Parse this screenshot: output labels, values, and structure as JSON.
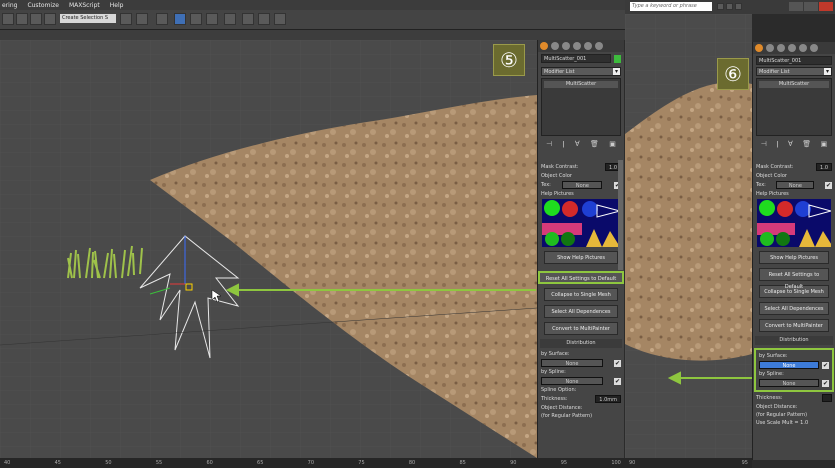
{
  "menu": [
    "ering",
    "Customize",
    "MAXScript",
    "Help"
  ],
  "toolbar": {
    "selection_filter": "Create Selection S"
  },
  "search": {
    "placeholder": "Type a keyword or phrase"
  },
  "ruler": [
    "40",
    "45",
    "50",
    "55",
    "60",
    "65",
    "70",
    "75",
    "80",
    "85",
    "90",
    "95",
    "100"
  ],
  "ruler2": [
    "90",
    "95"
  ],
  "steps": {
    "left": "⑤",
    "right": "⑥"
  },
  "left_panel": {
    "object_name": "MultiScatter_001",
    "modifier_list": "Modifier List",
    "stack_item": "MultiScatter",
    "mask_contrast_label": "Mask Contrast:",
    "mask_contrast_value": "1.0",
    "object_color_label": "Object Color",
    "tex_label": "Tex:",
    "tex_value": "None",
    "help_pictures_label": "Help Pictures",
    "show_help": "Show Help Pictures",
    "reset": "Reset All Settings to Default",
    "collapse": "Collapse to Single Mesh",
    "select_deps": "Select All Dependences",
    "convert": "Convert to MultiPainter",
    "distribution": "Distribution",
    "by_surface": "by Surface:",
    "surface_value": "None",
    "by_spline": "by Spline:",
    "spline_value": "None",
    "spline_option": "Spline Option:",
    "thickness_label": "Thickness:",
    "thickness_value": "1.0mm",
    "object_distance": "Object Distance:",
    "by_regular": "(for Regular Pattern)"
  },
  "right_panel": {
    "object_name": "MultiScatter_001",
    "modifier_list": "Modifier List",
    "stack_item": "MultiScatter",
    "mask_contrast_label": "Mask Contrast:",
    "mask_contrast_value": "1.0",
    "object_color_label": "Object Color",
    "tex_label": "Tex:",
    "tex_value": "None",
    "help_pictures_label": "Help Pictures",
    "show_help": "Show Help Pictures",
    "reset": "Reset All Settings to Default",
    "collapse": "Collapse to Single Mesh",
    "select_deps": "Select All Dependences",
    "convert": "Convert to MultiPainter",
    "distribution": "Distribution",
    "by_surface": "by Surface:",
    "surface_value": "None",
    "by_spline": "by Spline:",
    "spline_value": "None",
    "thickness_label": "Thickness:",
    "object_distance": "Object Distance:",
    "by_regular": "(for Regular Pattern)",
    "use_scale": "Use Scale Mult = 1.0"
  }
}
